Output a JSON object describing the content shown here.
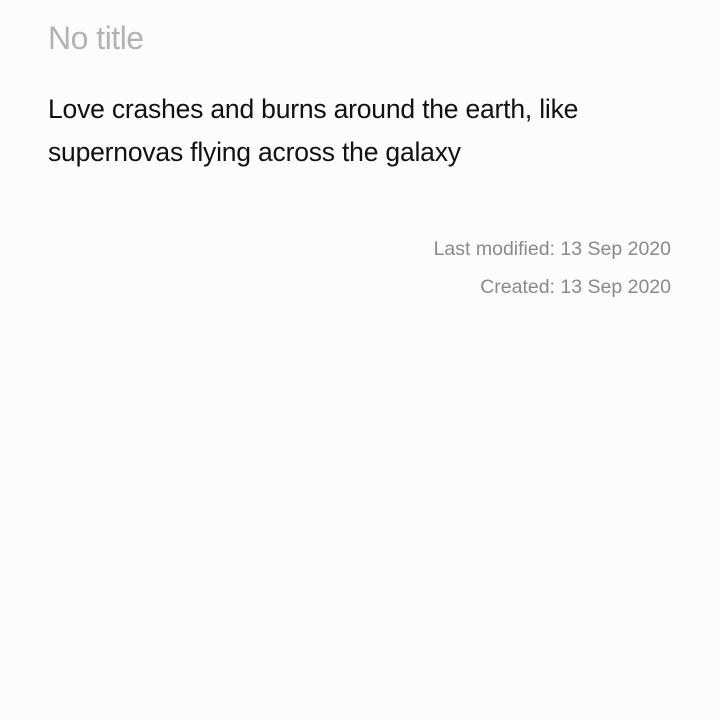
{
  "note": {
    "title_placeholder": "No title",
    "body": "Love crashes and burns around the earth, like supernovas flying across the galaxy",
    "last_modified": "Last modified: 13 Sep 2020",
    "created": "Created: 13 Sep 2020"
  }
}
